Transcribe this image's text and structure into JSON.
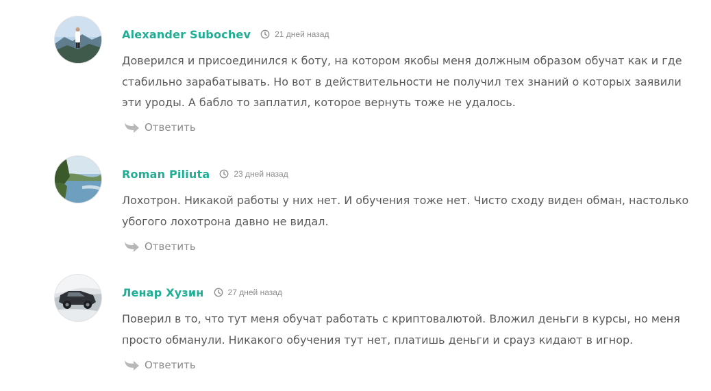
{
  "comments": [
    {
      "author": "Alexander Subochev",
      "date": "21 дней назад",
      "text": "Доверился и присоединился к боту, на котором якобы меня должным образом обучат как и где стабильно зарабатывать. Но вот в действительности не получил тех знаний о которых заявили эти уроды. А бабло то заплатил, которое вернуть тоже не удалось.",
      "reply_label": "Ответить",
      "avatar_icon": "avatar-mountain-photo"
    },
    {
      "author": "Roman Piliuta",
      "date": "23 дней назад",
      "text": "Лохотрон. Никакой работы у них нет. И обучения тоже нет. Чисто сходу виден обман, настолько убогого лохотрона давно не видал.",
      "reply_label": "Ответить",
      "avatar_icon": "avatar-lake-photo"
    },
    {
      "author": "Ленар Хузин",
      "date": "27 дней назад",
      "text": "Поверил в то, что тут меня обучат работать с криптовалютой. Вложил деньги в курсы, но меня просто обманули. Никакого обучения тут нет, платишь деньги и срауз кидают в игнор.",
      "reply_label": "Ответить",
      "avatar_icon": "avatar-car-photo"
    }
  ],
  "colors": {
    "author": "#1fae93",
    "text": "#5a5a5a",
    "meta": "#8a8a8a",
    "reply": "#8c8c8c"
  }
}
